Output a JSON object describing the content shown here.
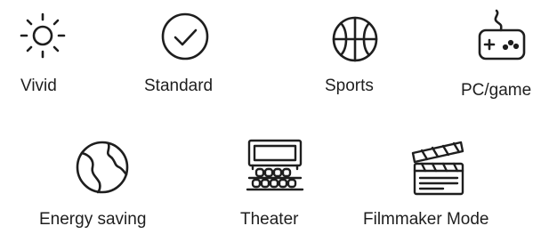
{
  "modes": [
    {
      "label": "Vivid",
      "icon": "sun-icon"
    },
    {
      "label": "Standard",
      "icon": "checkmark-circle-icon"
    },
    {
      "label": "Sports",
      "icon": "basketball-icon"
    },
    {
      "label": "PC/game",
      "icon": "gamepad-icon"
    },
    {
      "label": "Energy saving",
      "icon": "globe-leaf-icon"
    },
    {
      "label": "Theater",
      "icon": "theater-seats-icon"
    },
    {
      "label": "Filmmaker Mode",
      "icon": "clapperboard-icon"
    }
  ],
  "colors": {
    "icon_stroke": "#1e1e1e",
    "text": "#1e1e1e",
    "background": "#ffffff"
  }
}
